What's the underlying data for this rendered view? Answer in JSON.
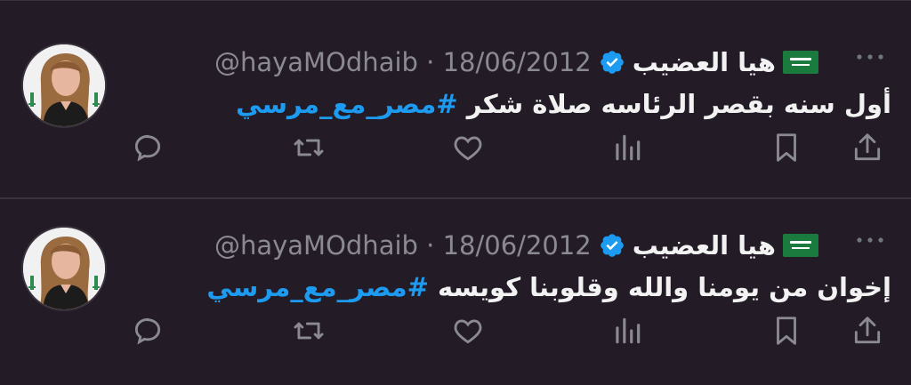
{
  "tweets": [
    {
      "author_name": "هيا العضيب",
      "flag_icon": "saudi-flag-icon",
      "verified": true,
      "handle": "@hayaMOdhaib",
      "separator": "·",
      "date": "18/06/2012",
      "text": "أول سنه بقصر الرئاسه صلاة شكر",
      "hashtag": "#مصر_مع_مرسي",
      "more_icon": "more-icon"
    },
    {
      "author_name": "هيا العضيب",
      "flag_icon": "saudi-flag-icon",
      "verified": true,
      "handle": "@hayaMOdhaib",
      "separator": "·",
      "date": "18/06/2012",
      "text": "إخوان من يومنا والله وقلوبنا كويسه",
      "hashtag": "#مصر_مع_مرسي",
      "more_icon": "more-icon"
    }
  ],
  "actions": {
    "reply_icon": "reply-icon",
    "retweet_icon": "retweet-icon",
    "like_icon": "like-icon",
    "views_icon": "views-icon",
    "bookmark_icon": "bookmark-icon",
    "share_icon": "share-icon"
  },
  "colors": {
    "background": "#231c27",
    "text": "#f2f2f2",
    "muted": "#8b8a91",
    "link": "#1d9bf0",
    "verified": "#1d9bf0",
    "divider": "#3a333d"
  }
}
